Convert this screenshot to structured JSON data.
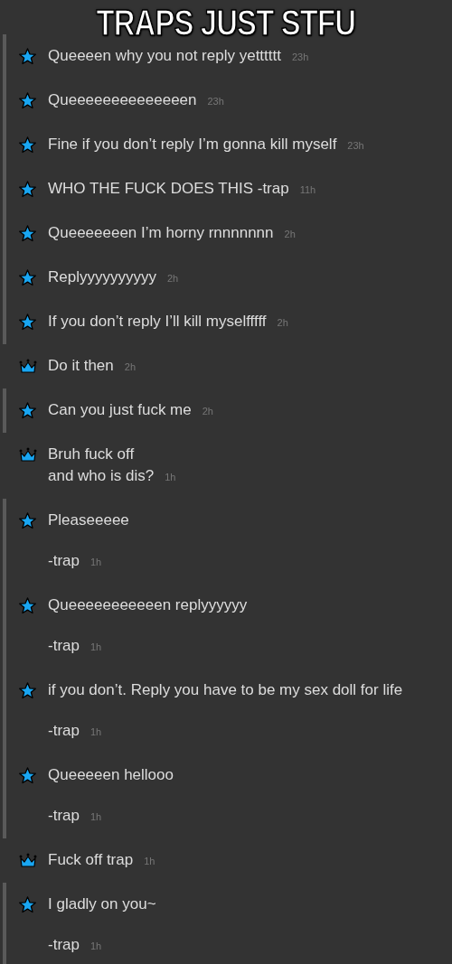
{
  "caption": "TRAPS JUST STFU",
  "groups": [
    {
      "kind": "star",
      "messages": [
        {
          "paragraphs": [
            "Queeeen why you not reply yetttttt"
          ],
          "time": "23h"
        },
        {
          "paragraphs": [
            "Queeeeeeeeeeeeeen"
          ],
          "time": "23h"
        },
        {
          "paragraphs": [
            "Fine if you don’t reply I’m gonna kill myself"
          ],
          "time": "23h"
        },
        {
          "paragraphs": [
            "WHO THE FUCK DOES THIS -trap"
          ],
          "time": "11h"
        },
        {
          "paragraphs": [
            "Queeeeeeen I’m horny rnnnnnnn"
          ],
          "time": "2h"
        },
        {
          "paragraphs": [
            "Replyyyyyyyyyy"
          ],
          "time": "2h"
        },
        {
          "paragraphs": [
            "If you don’t reply I’ll kill myselfffff"
          ],
          "time": "2h"
        }
      ]
    },
    {
      "kind": "crown",
      "messages": [
        {
          "paragraphs": [
            "Do it then"
          ],
          "time": "2h"
        }
      ]
    },
    {
      "kind": "star",
      "messages": [
        {
          "paragraphs": [
            "Can you just fuck me"
          ],
          "time": "2h"
        }
      ]
    },
    {
      "kind": "crown",
      "messages": [
        {
          "paragraphs": [
            "Bruh fuck off\nand who is dis?"
          ],
          "time": "1h"
        }
      ]
    },
    {
      "kind": "star",
      "messages": [
        {
          "paragraphs": [
            "Pleaseeeee",
            "-trap"
          ],
          "time": "1h"
        },
        {
          "paragraphs": [
            "Queeeeeeeeeeen replyyyyyy",
            "-trap"
          ],
          "time": "1h"
        },
        {
          "paragraphs": [
            "if you don’t. Reply you have to be my sex doll for life",
            "-trap"
          ],
          "time": "1h"
        },
        {
          "paragraphs": [
            "Queeeeen hellooo",
            "-trap"
          ],
          "time": "1h"
        }
      ]
    },
    {
      "kind": "crown",
      "messages": [
        {
          "paragraphs": [
            "Fuck off trap"
          ],
          "time": "1h"
        }
      ]
    },
    {
      "kind": "star",
      "messages": [
        {
          "paragraphs": [
            "I gladly on you~",
            "-trap"
          ],
          "time": "1h"
        }
      ]
    }
  ]
}
